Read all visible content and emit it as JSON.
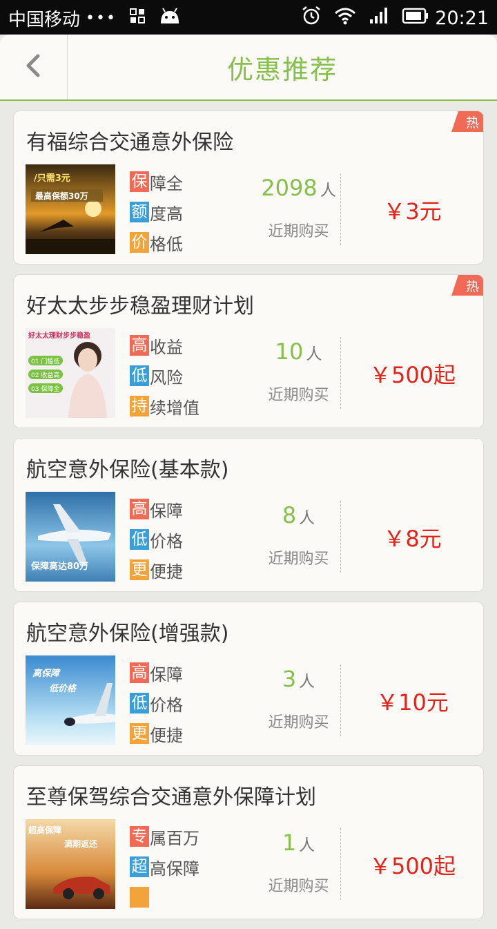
{
  "status": {
    "carrier": "中国移动",
    "dots": "•••",
    "time": "20:21",
    "icons": [
      "apps-grid-icon",
      "android-icon",
      "alarm-icon",
      "wifi-icon",
      "signal-icon",
      "battery-icon"
    ]
  },
  "header": {
    "title": "优惠推荐",
    "back_icon": "chevron-left-icon"
  },
  "colors": {
    "accent_green": "#86bf4b",
    "price_red": "#e2231a",
    "chip_red": "#f06a55",
    "chip_blue": "#3a9fd8",
    "chip_orange": "#f2a33a"
  },
  "products": [
    {
      "name": "有福综合交通意外保险",
      "hot": true,
      "hot_label": "热",
      "thumb_text1": "/只需3元",
      "thumb_text2": "最高保额30万",
      "features": [
        {
          "chip": "保",
          "rest": "障全"
        },
        {
          "chip": "额",
          "rest": "度高"
        },
        {
          "chip": "价",
          "rest": "格低"
        }
      ],
      "buyer_count": "2098",
      "buyer_unit": "人",
      "buyer_label": "近期购买",
      "price": "￥3元"
    },
    {
      "name": "好太太步步稳盈理财计划",
      "hot": true,
      "hot_label": "热",
      "thumb_text1": "好太太理财步步稳盈",
      "thumb_badges": [
        "01 门槛低",
        "02 收益高",
        "03 保障全"
      ],
      "features": [
        {
          "chip": "高",
          "rest": "收益"
        },
        {
          "chip": "低",
          "rest": "风险"
        },
        {
          "chip": "持",
          "rest": "续增值"
        }
      ],
      "buyer_count": "10",
      "buyer_unit": "人",
      "buyer_label": "近期购买",
      "price": "￥500起"
    },
    {
      "name": "航空意外保险(基本款)",
      "hot": false,
      "thumb_text1": "保障高达80万",
      "features": [
        {
          "chip": "高",
          "rest": "保障"
        },
        {
          "chip": "低",
          "rest": "价格"
        },
        {
          "chip": "更",
          "rest": "便捷"
        }
      ],
      "buyer_count": "8",
      "buyer_unit": "人",
      "buyer_label": "近期购买",
      "price": "￥8元"
    },
    {
      "name": "航空意外保险(增强款)",
      "hot": false,
      "thumb_text1": "高保障",
      "thumb_text2": "低价格",
      "features": [
        {
          "chip": "高",
          "rest": "保障"
        },
        {
          "chip": "低",
          "rest": "价格"
        },
        {
          "chip": "更",
          "rest": "便捷"
        }
      ],
      "buyer_count": "3",
      "buyer_unit": "人",
      "buyer_label": "近期购买",
      "price": "￥10元"
    },
    {
      "name": "至尊保驾综合交通意外保障计划",
      "hot": false,
      "thumb_text1": "超高保障",
      "thumb_text2": "满期返还",
      "features": [
        {
          "chip": "专",
          "rest": "属百万"
        },
        {
          "chip": "超",
          "rest": "高保障"
        },
        {
          "chip": "",
          "rest": ""
        }
      ],
      "buyer_count": "1",
      "buyer_unit": "人",
      "buyer_label": "近期购买",
      "price": "￥500起"
    }
  ]
}
